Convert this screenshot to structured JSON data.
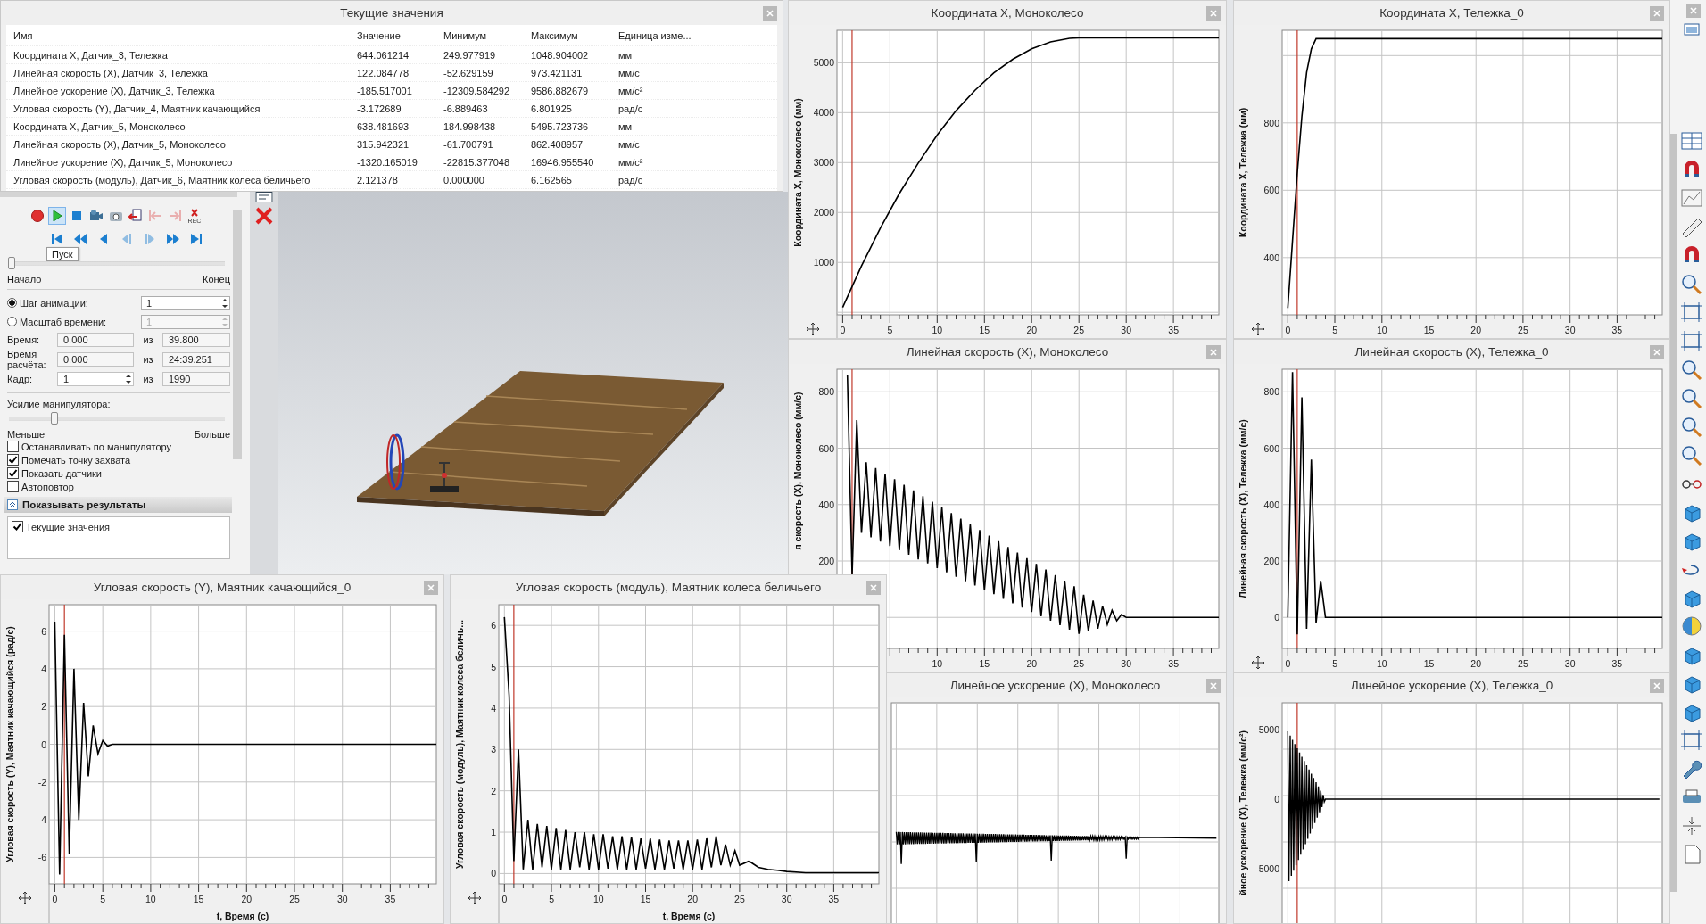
{
  "table_window": {
    "title": "Текущие значения",
    "columns": [
      "Имя",
      "Значение",
      "Минимум",
      "Максимум",
      "Единица изме..."
    ],
    "rows": [
      [
        "Координата X, Датчик_3, Тележка",
        "644.061214",
        "249.977919",
        "1048.904002",
        "мм"
      ],
      [
        "Линейная скорость (X), Датчик_3, Тележка",
        "122.084778",
        "-52.629159",
        "973.421131",
        "мм/с"
      ],
      [
        "Линейное ускорение (X), Датчик_3, Тележка",
        "-185.517001",
        "-12309.584292",
        "9586.882679",
        "мм/с²"
      ],
      [
        "Угловая скорость (Y), Датчик_4, Маятник качающийся",
        "-3.172689",
        "-6.889463",
        "6.801925",
        "рад/с"
      ],
      [
        "Координата X, Датчик_5, Моноколесо",
        "638.481693",
        "184.998438",
        "5495.723736",
        "мм"
      ],
      [
        "Линейная скорость (X), Датчик_5, Моноколесо",
        "315.942321",
        "-61.700791",
        "862.408957",
        "мм/с"
      ],
      [
        "Линейное ускорение (X), Датчик_5, Моноколесо",
        "-1320.165019",
        "-22815.377048",
        "16946.955540",
        "мм/с²"
      ],
      [
        "Угловая скорость (модуль), Датчик_6, Маятник колеса беличьего",
        "2.121378",
        "0.000000",
        "6.162565",
        "рад/с"
      ]
    ]
  },
  "control_panel": {
    "media_buttons": [
      {
        "kind": "record",
        "disabled": false,
        "hovered": false
      },
      {
        "kind": "play",
        "disabled": false,
        "hovered": true
      },
      {
        "kind": "stop",
        "disabled": false,
        "hovered": false
      },
      {
        "kind": "video",
        "disabled": false,
        "hovered": false
      },
      {
        "kind": "camera",
        "disabled": false,
        "hovered": false
      },
      {
        "kind": "export",
        "disabled": false,
        "hovered": false
      },
      {
        "kind": "mark_start",
        "disabled": true,
        "hovered": false
      },
      {
        "kind": "mark_end",
        "disabled": true,
        "hovered": false
      },
      {
        "kind": "rec",
        "disabled": false,
        "hovered": false,
        "label": "REC"
      }
    ],
    "nav_buttons": [
      {
        "kind": "first",
        "disabled": false
      },
      {
        "kind": "fast_back",
        "disabled": false
      },
      {
        "kind": "back",
        "disabled": false
      },
      {
        "kind": "frame_back",
        "disabled": true
      },
      {
        "kind": "frame_forward",
        "disabled": true
      },
      {
        "kind": "fast_forward",
        "disabled": false
      },
      {
        "kind": "last",
        "disabled": false
      }
    ],
    "tooltip": "Пуск",
    "timeline": {
      "level": 0,
      "start_label": "Начало",
      "end_label": "Конец"
    },
    "modes": [
      {
        "label": "Шаг анимации:",
        "selected": true,
        "value": "1",
        "disabled": false
      },
      {
        "label": "Масштаб времени:",
        "selected": false,
        "value": "1",
        "disabled": true
      }
    ],
    "fields": [
      {
        "label": "Время:",
        "value": "0.000",
        "of": "из",
        "total": "39.800",
        "kind": "text"
      },
      {
        "label": "Время расчёта:",
        "value": "0.000",
        "of": "из",
        "total": "24:39.251",
        "kind": "text"
      },
      {
        "label": "Кадр:",
        "value": "1",
        "of": "из",
        "total": "1990",
        "kind": "spinner"
      }
    ],
    "force": {
      "label": "Усилие манипулятора:",
      "level": 0.2,
      "min_label": "Меньше",
      "max_label": "Больше"
    },
    "options": [
      {
        "label": "Останавливать по манипулятору",
        "checked": false
      },
      {
        "label": "Помечать точку захвата",
        "checked": true
      },
      {
        "label": "Показать датчики",
        "checked": true
      },
      {
        "label": "Автоповтор",
        "checked": false
      }
    ],
    "results_section": {
      "title": "Показывать результаты",
      "expanded": true,
      "items": [
        {
          "label": "Текущие значения",
          "checked": true
        }
      ]
    }
  },
  "charts": [
    {
      "title": "Координата X, Моноколесо",
      "chart_data": {
        "type": "line",
        "ylabel": "Координата X, Моноколесо (мм)",
        "grid": true,
        "xlim": [
          -0.6,
          39.8
        ],
        "ylim": [
          -50,
          5650
        ],
        "xticks": [
          0,
          5,
          10,
          15,
          20,
          25,
          30,
          35
        ],
        "yticks": [
          1000,
          2000,
          3000,
          4000,
          5000
        ],
        "x": [
          0,
          2,
          4,
          6,
          8,
          10,
          12,
          14,
          16,
          18,
          20,
          22,
          24,
          25,
          30,
          35,
          39.8
        ],
        "values": [
          100,
          930,
          1690,
          2380,
          2990,
          3550,
          4040,
          4450,
          4800,
          5070,
          5280,
          5420,
          5490,
          5500,
          5500,
          5500,
          5500
        ],
        "ref_lines": [
          {
            "axis": "x",
            "value": 1,
            "color": "#c0392b"
          }
        ]
      }
    },
    {
      "title": "Координата X, Тележка_0",
      "chart_data": {
        "type": "line",
        "ylabel": "Координата X, Тележка (мм)",
        "grid": true,
        "xlim": [
          -0.6,
          39.8
        ],
        "ylim": [
          230,
          1075
        ],
        "xticks": [
          0,
          5,
          10,
          15,
          20,
          25,
          30,
          35
        ],
        "yticks": [
          400,
          600,
          800
        ],
        "x": [
          0,
          0.5,
          1,
          1.5,
          2,
          2.5,
          3,
          5,
          39.8
        ],
        "values": [
          250,
          450,
          650,
          820,
          950,
          1020,
          1050,
          1050,
          1050
        ],
        "ref_lines": [
          {
            "axis": "x",
            "value": 1,
            "color": "#c0392b"
          }
        ]
      }
    },
    {
      "title": "Линейная скорость (X), Моноколесо",
      "chart_data": {
        "type": "line",
        "ylabel": "я скорость (X), Моноколесо (мм/с)",
        "grid": true,
        "xlim": [
          -0.6,
          39.8
        ],
        "ylim": [
          -110,
          880
        ],
        "xticks": [
          10,
          15,
          20,
          25,
          30,
          35
        ],
        "yticks": [
          200,
          400,
          600,
          800
        ],
        "x": [
          0.5,
          1,
          1.5,
          2,
          2.5,
          3,
          3.5,
          4,
          4.5,
          5,
          5.5,
          6,
          6.5,
          7,
          7.5,
          8,
          8.5,
          9,
          9.5,
          10,
          10.5,
          11,
          11.5,
          12,
          12.5,
          13,
          13.5,
          14,
          14.5,
          15,
          15.5,
          16,
          16.5,
          17,
          17.5,
          18,
          18.5,
          19,
          19.5,
          20,
          20.5,
          21,
          21.5,
          22,
          22.5,
          23,
          23.5,
          24,
          24.5,
          25,
          25.5,
          26,
          26.5,
          27,
          27.5,
          28,
          28.5,
          29,
          29.5,
          30,
          35,
          39.8
        ],
        "values": [
          860,
          150,
          700,
          300,
          550,
          284,
          530,
          269,
          510,
          253,
          490,
          238,
          470,
          222,
          450,
          206,
          430,
          191,
          410,
          175,
          390,
          160,
          370,
          144,
          350,
          128,
          330,
          113,
          310,
          97,
          290,
          82,
          270,
          66,
          250,
          50,
          230,
          35,
          210,
          19,
          190,
          4,
          170,
          -12,
          150,
          -27,
          130,
          -43,
          110,
          -58,
          80,
          -50,
          60,
          -40,
          40,
          -25,
          25,
          -12,
          10,
          0,
          0,
          0
        ],
        "ref_lines": [
          {
            "axis": "x",
            "value": 1,
            "color": "#c0392b"
          }
        ]
      }
    },
    {
      "title": "Линейная скорость (X), Тележка_0",
      "chart_data": {
        "type": "line",
        "ylabel": "Линейная скорость (X), Тележка (мм/с)",
        "grid": true,
        "xlim": [
          -0.6,
          39.8
        ],
        "ylim": [
          -110,
          880
        ],
        "xticks": [
          0,
          5,
          10,
          15,
          20,
          25,
          30,
          35
        ],
        "yticks": [
          0,
          200,
          400,
          600,
          800
        ],
        "x": [
          0,
          0.5,
          1,
          1.5,
          2,
          2.5,
          3,
          3.5,
          4,
          39.8
        ],
        "values": [
          0,
          870,
          -60,
          780,
          -40,
          560,
          -20,
          130,
          0,
          0
        ],
        "ref_lines": [
          {
            "axis": "x",
            "value": 1,
            "color": "#c0392b"
          }
        ]
      }
    },
    {
      "title": "Линейное ускорение (X), Моноколесо"
    },
    {
      "title": "Линейное ускорение (X), Тележка_0",
      "ylabel": "йное ускорение (X), Тележка (мм/с²)",
      "ytick_labels": [
        "5000",
        "0",
        "-5000"
      ]
    },
    {
      "title": "Угловая скорость (Y), Маятник качающийся_0",
      "chart_data": {
        "type": "line",
        "ylabel": "Угловая скорость (Y), Маятник качающийся (рад/с)",
        "xlabel": "t, Время (с)",
        "grid": true,
        "xlim": [
          -0.6,
          39.8
        ],
        "ylim": [
          -7.4,
          7.4
        ],
        "xticks": [
          0,
          5,
          10,
          15,
          20,
          25,
          30,
          35
        ],
        "yticks": [
          -6,
          -4,
          -2,
          0,
          2,
          4,
          6
        ],
        "x": [
          0,
          0.5,
          1,
          1.5,
          2,
          2.5,
          3,
          3.5,
          4,
          4.5,
          5,
          5.5,
          6,
          39.8
        ],
        "values": [
          6.5,
          -6.9,
          5.8,
          -5.8,
          4,
          -4,
          2.2,
          -1.7,
          1,
          -0.5,
          0.2,
          -0.1,
          0,
          0
        ],
        "ref_lines": [
          {
            "axis": "x",
            "value": 1,
            "color": "#c0392b"
          }
        ]
      }
    },
    {
      "title": "Угловая скорость (модуль), Маятник колеса беличьего",
      "chart_data": {
        "type": "line",
        "ylabel": "Угловая скорость (модуль), Маятник колеса беличь...",
        "xlabel": "t, Время (с)",
        "grid": true,
        "xlim": [
          -0.6,
          39.8
        ],
        "ylim": [
          -0.25,
          6.5
        ],
        "xticks": [
          0,
          5,
          10,
          15,
          20,
          25,
          30,
          35
        ],
        "yticks": [
          0,
          1,
          2,
          3,
          4,
          5,
          6
        ],
        "x": [
          0,
          0.5,
          1,
          1.5,
          2,
          2.5,
          3,
          3.5,
          4,
          4.5,
          5,
          5.5,
          6,
          6.5,
          7,
          7.5,
          8,
          8.5,
          9,
          9.5,
          10,
          10.5,
          11,
          11.5,
          12,
          12.5,
          13,
          13.5,
          14,
          14.5,
          15,
          15.5,
          16,
          16.5,
          17,
          17.5,
          18,
          18.5,
          19,
          19.5,
          20,
          20.5,
          21,
          21.5,
          22,
          22.5,
          23,
          23.5,
          24,
          24.5,
          25,
          26,
          27,
          28,
          29,
          30,
          32,
          39.8
        ],
        "values": [
          6.2,
          4.3,
          0.3,
          3.0,
          0.1,
          1.3,
          0.1,
          1.2,
          0.15,
          1.15,
          0.1,
          1.1,
          0.1,
          1.05,
          0.1,
          1.0,
          0.15,
          1.0,
          0.1,
          0.95,
          0.1,
          0.95,
          0.12,
          0.9,
          0.1,
          0.9,
          0.1,
          0.88,
          0.1,
          0.85,
          0.12,
          0.85,
          0.1,
          0.82,
          0.1,
          0.8,
          0.12,
          0.8,
          0.1,
          0.8,
          0.1,
          0.82,
          0.1,
          0.85,
          0.15,
          0.9,
          0.2,
          0.7,
          0.2,
          0.55,
          0.2,
          0.3,
          0.15,
          0.1,
          0.08,
          0.05,
          0.02,
          0.02
        ],
        "ref_lines": [
          {
            "axis": "x",
            "value": 1,
            "color": "#c0392b"
          }
        ]
      }
    }
  ]
}
